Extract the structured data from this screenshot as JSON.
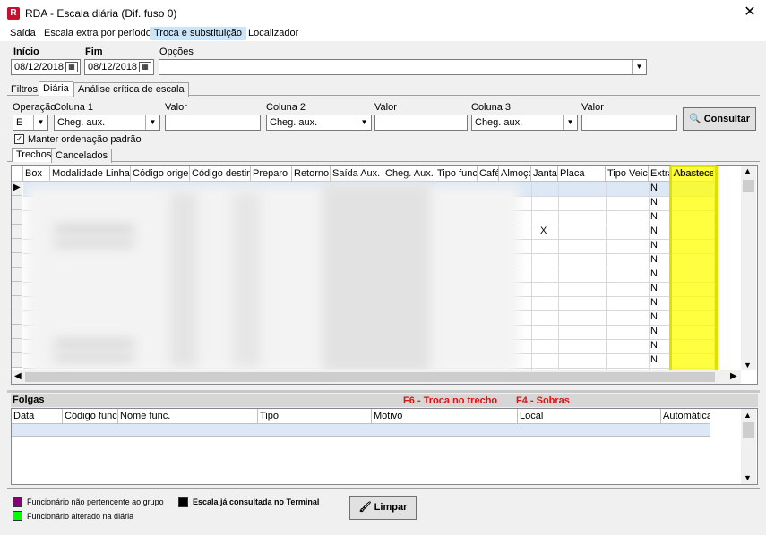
{
  "window": {
    "title": "RDA - Escala diária (Dif. fuso 0)",
    "icon": "rda-app-icon",
    "close_glyph": "✕"
  },
  "menu": [
    "Saída",
    "Escala extra por período",
    "Troca e substituição",
    "Localizador"
  ],
  "filters": {
    "inicio_label": "Início",
    "inicio_value": "08/12/2018",
    "fim_label": "Fim",
    "fim_value": "08/12/2018",
    "opcoes_label": "Opções",
    "opcoes_value": ""
  },
  "top_tabs": [
    "Filtros",
    "Diária",
    "Análise crítica de escala"
  ],
  "operation": {
    "operacao_label": "Operação",
    "operacao_value": "E",
    "col1_label": "Coluna 1",
    "col1_value": "Cheg. aux.",
    "valor1_label": "Valor",
    "col2_label": "Coluna 2",
    "col2_value": "Cheg. aux.",
    "valor2_label": "Valor",
    "col3_label": "Coluna 3",
    "col3_value": "Cheg. aux.",
    "valor3_label": "Valor",
    "consultar_label": "Consultar",
    "manter_label": "Manter ordenação padrão",
    "manter_checked": true
  },
  "grid_tabs": [
    "Trechos",
    "Cancelados"
  ],
  "grid": {
    "columns": [
      "Box",
      "Modalidade Linha",
      "Código origem",
      "Código destino",
      "Preparo",
      "Retorno",
      "Saída Aux.",
      "Cheg. Aux.",
      "Tipo func.",
      "Café",
      "Almoço",
      "Jantar",
      "Placa",
      "Tipo Veic.",
      "Extra",
      "Abastece"
    ],
    "extra_values": [
      "N",
      "N",
      "N",
      "N",
      "N",
      "N",
      "N",
      "N",
      "N",
      "N",
      "N",
      "N",
      "N"
    ],
    "jantar_mark": "X"
  },
  "folgas": {
    "title": "Folgas",
    "shortcut1": "F6 - Troca no trecho",
    "shortcut2": "F4 - Sobras",
    "columns": [
      "Data",
      "Código func.",
      "Nome func.",
      "Tipo",
      "Motivo",
      "Local",
      "Automática"
    ]
  },
  "legend": {
    "item1": "Funcionário não pertencente ao grupo",
    "item1_color": "#800080",
    "item2": "Escala já consultada no Terminal",
    "item2_color": "#000000",
    "item3": "Funcionário alterado na diária",
    "item3_color": "#00ff00"
  },
  "limpar_label": "Limpar",
  "highlight_color": "#ffff00"
}
